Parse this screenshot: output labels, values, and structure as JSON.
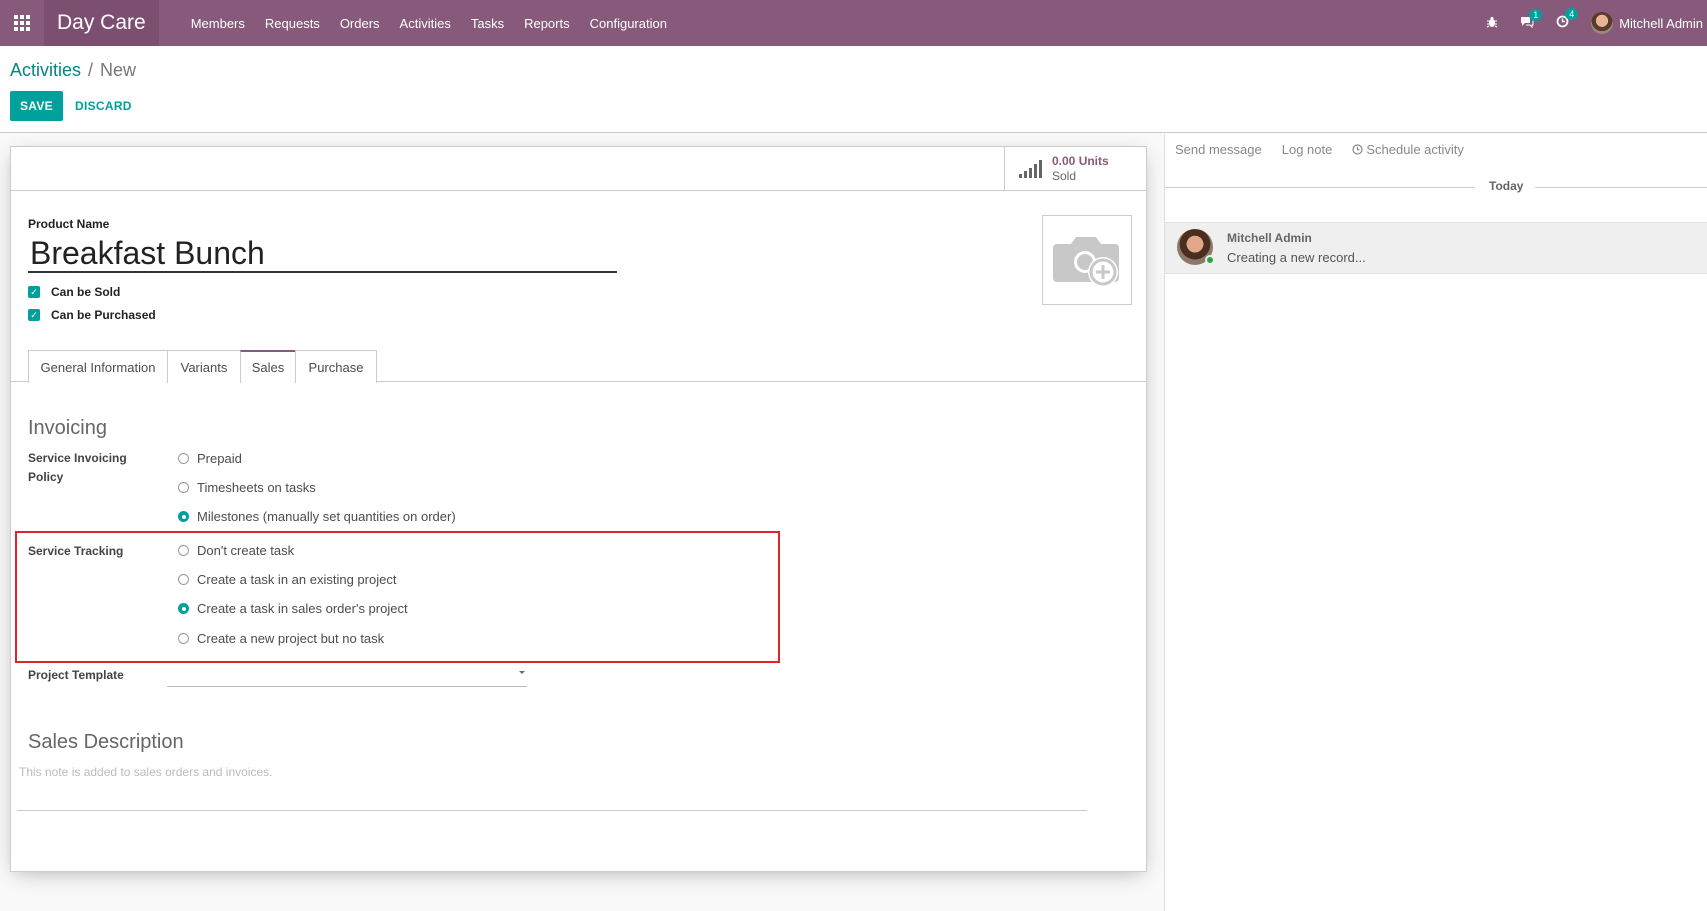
{
  "navbar": {
    "app_name": "Day Care",
    "menu": [
      "Members",
      "Requests",
      "Orders",
      "Activities",
      "Tasks",
      "Reports",
      "Configuration"
    ],
    "messages_badge": "1",
    "activities_badge": "4",
    "user_name": "Mitchell Admin"
  },
  "control_panel": {
    "breadcrumb_parent": "Activities",
    "breadcrumb_separator": "/",
    "breadcrumb_current": "New",
    "save_label": "SAVE",
    "discard_label": "DISCARD"
  },
  "form": {
    "stat_value": "0.00 Units",
    "stat_label": "Sold",
    "product_name_label": "Product Name",
    "product_name": "Breakfast Bunch",
    "can_be_sold": "Can be Sold",
    "can_be_purchased": "Can be Purchased",
    "tabs": [
      "General Information",
      "Variants",
      "Sales",
      "Purchase"
    ],
    "active_tab": "Sales",
    "invoicing_title": "Invoicing",
    "service_invoicing_policy_label": "Service Invoicing Policy",
    "invoicing_options": [
      "Prepaid",
      "Timesheets on tasks",
      "Milestones (manually set quantities on order)"
    ],
    "invoicing_selected": "Milestones (manually set quantities on order)",
    "service_tracking_label": "Service Tracking",
    "tracking_options": [
      "Don't create task",
      "Create a task in an existing project",
      "Create a task in sales order's project",
      "Create a new project but no task"
    ],
    "tracking_selected": "Create a task in sales order's project",
    "project_template_label": "Project Template",
    "project_template_value": "",
    "sales_description_title": "Sales Description",
    "sales_description_placeholder": "This note is added to sales orders and invoices."
  },
  "chatter": {
    "send_message": "Send message",
    "log_note": "Log note",
    "schedule_activity": "Schedule activity",
    "date_separator": "Today",
    "message_author": "Mitchell Admin",
    "message_body": "Creating a new record..."
  },
  "colors": {
    "navbar": "#875a7b",
    "accent": "#00a09d",
    "highlight": "#e0242d"
  }
}
